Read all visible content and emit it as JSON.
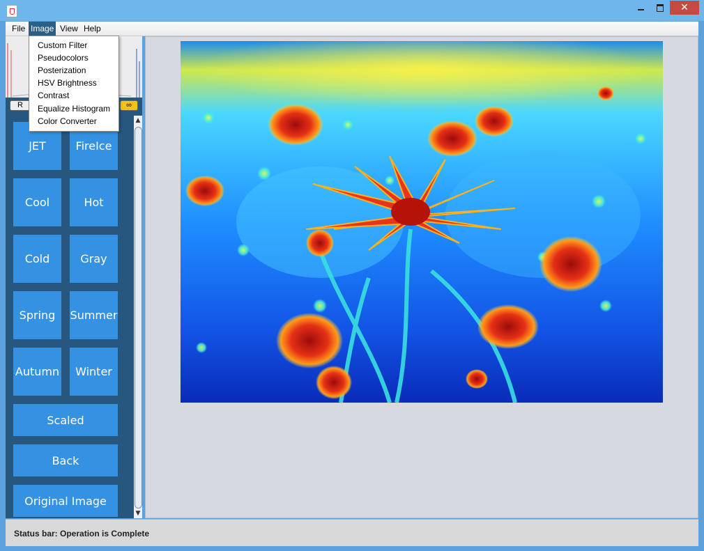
{
  "window": {
    "close_glyph": "✕"
  },
  "menubar": {
    "file": "File",
    "image": "Image",
    "view": "View",
    "help": "Help"
  },
  "histogram": {
    "r_label": "R",
    "infinity_label": "∞"
  },
  "image_menu": {
    "items": [
      "Custom Filter",
      "Pseudocolors",
      "Posterization",
      "HSV Brightness",
      "Contrast",
      "Equalize Histogram",
      "Color Converter"
    ]
  },
  "pseudocolor_buttons": {
    "jet": "JET",
    "fireice": "FireIce",
    "cool": "Cool",
    "hot": "Hot",
    "cold": "Cold",
    "gray": "Gray",
    "spring": "Spring",
    "summer": "Summer",
    "autumn": "Autumn",
    "winter": "Winter",
    "scaled": "Scaled",
    "back": "Back",
    "original": "Original Image"
  },
  "scrollbar": {
    "up_glyph": "▲",
    "down_glyph": "▼"
  },
  "status": {
    "text": "Status bar: Operation is Complete"
  },
  "colors": {
    "accent": "#3592e2",
    "panel": "#27577f",
    "menu_active": "#2a5f86"
  }
}
